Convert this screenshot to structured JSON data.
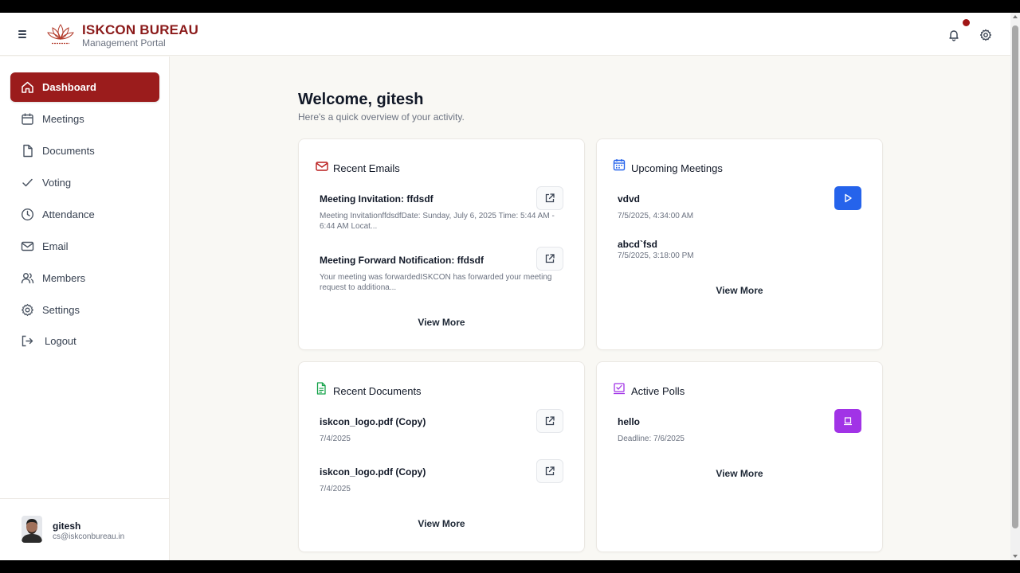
{
  "header": {
    "brand_title": "ISKCON BUREAU",
    "brand_subtitle": "Management Portal",
    "icons": [
      "menu-icon",
      "lotus-logo",
      "bell-icon",
      "gear-icon"
    ]
  },
  "sidebar": {
    "items": [
      {
        "label": "Dashboard",
        "icon": "home-icon",
        "active": true
      },
      {
        "label": "Meetings",
        "icon": "calendar-icon"
      },
      {
        "label": "Documents",
        "icon": "file-icon"
      },
      {
        "label": "Voting",
        "icon": "check-icon"
      },
      {
        "label": "Attendance",
        "icon": "clock-icon"
      },
      {
        "label": "Email",
        "icon": "mail-icon"
      },
      {
        "label": "Members",
        "icon": "users-icon"
      },
      {
        "label": "Settings",
        "icon": "gear-icon"
      },
      {
        "label": "Logout",
        "icon": "logout-icon"
      }
    ],
    "user": {
      "name": "gitesh",
      "email": "cs@iskconbureau.in"
    }
  },
  "main": {
    "welcome": "Welcome, gitesh",
    "welcome_sub": "Here's a quick overview of your activity.",
    "recent_emails": {
      "title": "Recent Emails",
      "items": [
        {
          "title": "Meeting Invitation: ffdsdf",
          "preview_line1": "Meeting InvitationffdsdfDate: Sunday, July 6, 2025 Time: 5:44 AM -",
          "preview_line2": "6:44 AM Locat..."
        },
        {
          "title": "Meeting Forward Notification: ffdsdf",
          "preview_line1": "Your meeting was forwardedISKCON has forwarded your meeting",
          "preview_line2": "request to additiona..."
        }
      ],
      "view_more": "View More"
    },
    "upcoming_meetings": {
      "title": "Upcoming Meetings",
      "items": [
        {
          "title": "vdvd",
          "time": "7/5/2025, 4:34:00 AM"
        },
        {
          "title": "abcd`fsd",
          "time": "7/5/2025, 3:18:00 PM"
        }
      ],
      "view_more": "View More"
    },
    "recent_documents": {
      "title": "Recent Documents",
      "items": [
        {
          "title": "iskcon_logo.pdf (Copy)",
          "date": "7/4/2025"
        },
        {
          "title": "iskcon_logo.pdf (Copy)",
          "date": "7/4/2025"
        }
      ],
      "view_more": "View More"
    },
    "active_polls": {
      "title": "Active Polls",
      "items": [
        {
          "title": "hello",
          "deadline": "Deadline: 7/6/2025"
        }
      ],
      "view_more": "View More"
    }
  },
  "colors": {
    "brand": "#8b1a1a",
    "active_nav": "#9b1c1c",
    "play_button": "#2563eb",
    "poll_button": "#a133e6",
    "background": "#f9f8f4"
  }
}
